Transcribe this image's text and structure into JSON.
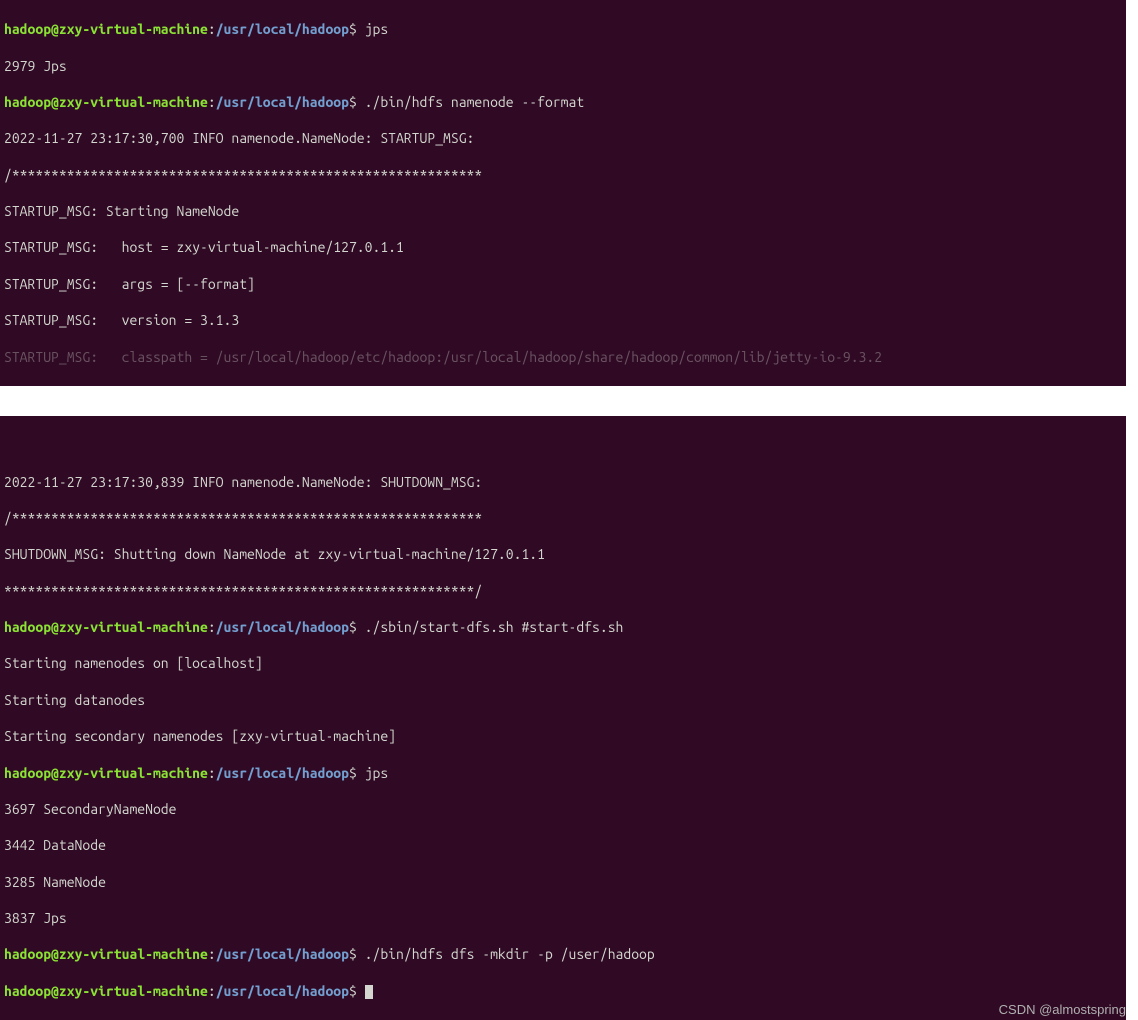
{
  "prompt": {
    "user": "hadoop@zxy-virtual-machine",
    "sep1": ":",
    "path": "/usr/local/hadoop",
    "sep2": "$"
  },
  "term1": {
    "top_frag": "",
    "cmd1": "jps",
    "out1": "2979 Jps",
    "cmd2": "./bin/hdfs namenode --format",
    "out2_l1": "2022-11-27 23:17:30,700 INFO namenode.NameNode: STARTUP_MSG:",
    "out2_l2": "/************************************************************",
    "out2_l3": "STARTUP_MSG: Starting NameNode",
    "out2_l4": "STARTUP_MSG:   host = zxy-virtual-machine/127.0.1.1",
    "out2_l5": "STARTUP_MSG:   args = [--format]",
    "out2_l6": "STARTUP_MSG:   version = 3.1.3",
    "out2_l7": "STARTUP_MSG:   classpath = /usr/local/hadoop/etc/hadoop:/usr/local/hadoop/share/hadoop/common/lib/jetty-io-9.3.2"
  },
  "term2": {
    "l1": "2022-11-27 23:17:30,839 INFO namenode.NameNode: SHUTDOWN_MSG:",
    "l2": "/************************************************************",
    "l3": "SHUTDOWN_MSG: Shutting down NameNode at zxy-virtual-machine/127.0.1.1",
    "l4": "************************************************************/",
    "cmd1": "./sbin/start-dfs.sh #start-dfs.sh",
    "o1": "Starting namenodes on [localhost]",
    "o2": "Starting datanodes",
    "o3": "Starting secondary namenodes [zxy-virtual-machine]",
    "cmd2": "jps",
    "j1": "3697 SecondaryNameNode",
    "j2": "3442 DataNode",
    "j3": "3285 NameNode",
    "j4": "3837 Jps",
    "cmd3": "./bin/hdfs dfs -mkdir -p /user/hadoop",
    "cmd4": ""
  },
  "watermark": "CSDN @almostspring"
}
